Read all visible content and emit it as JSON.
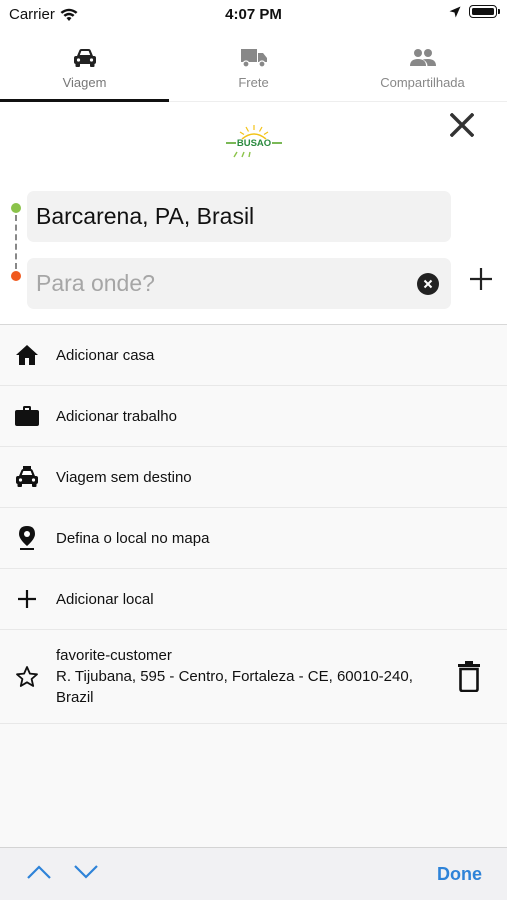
{
  "status_bar": {
    "carrier": "Carrier",
    "time": "4:07 PM"
  },
  "tabs": [
    {
      "label": "Viagem",
      "icon": "car-icon",
      "active": true
    },
    {
      "label": "Frete",
      "icon": "truck-icon",
      "active": false
    },
    {
      "label": "Compartilhada",
      "icon": "people-icon",
      "active": false
    }
  ],
  "logo": {
    "text": "BUSAO"
  },
  "route": {
    "origin": "Barcarena, PA, Brasil",
    "destination_placeholder": "Para onde?",
    "destination_value": ""
  },
  "list": {
    "items": [
      {
        "label": "Adicionar casa",
        "icon": "home-icon"
      },
      {
        "label": "Adicionar trabalho",
        "icon": "briefcase-icon"
      },
      {
        "label": "Viagem sem destino",
        "icon": "taxi-icon"
      },
      {
        "label": "Defina o local no mapa",
        "icon": "map-pin-icon"
      },
      {
        "label": "Adicionar local",
        "icon": "plus-icon"
      }
    ],
    "favorite": {
      "name": "favorite-customer",
      "address": "R. Tijubana, 595 - Centro, Fortaleza - CE, 60010-240, Brazil",
      "icon": "star-icon"
    }
  },
  "toolbar": {
    "done_label": "Done"
  },
  "colors": {
    "accent": "#2e83d8",
    "origin_dot": "#8bc34a",
    "destination_dot": "#f0591e"
  }
}
